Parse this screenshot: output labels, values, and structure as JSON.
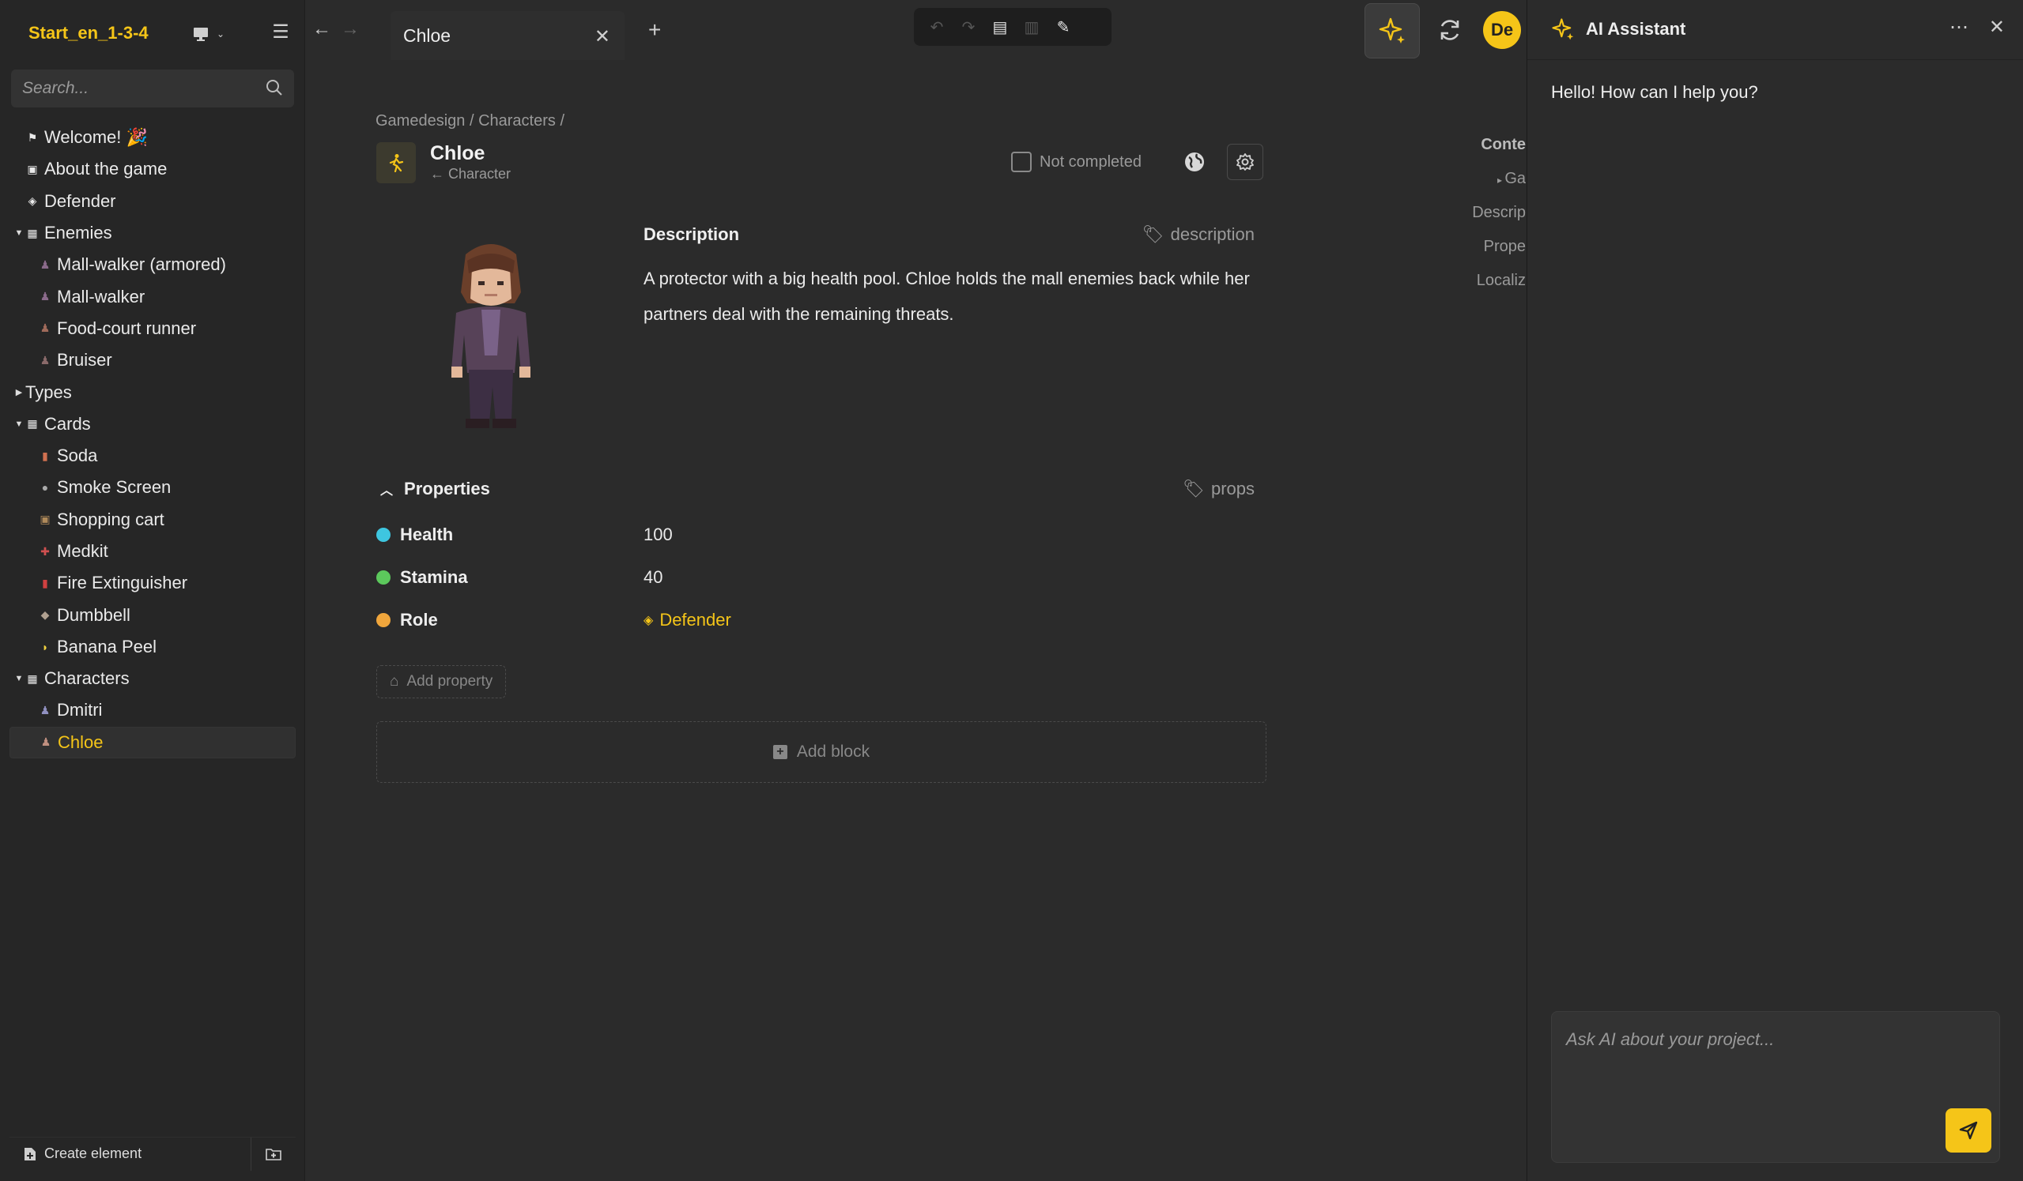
{
  "project": {
    "title": "Start_en_1-3-4"
  },
  "search": {
    "placeholder": "Search..."
  },
  "tree": {
    "welcome": "Welcome! 🎉",
    "about": "About the game",
    "defender": "Defender",
    "enemies": "Enemies",
    "enemy_items": [
      "Mall-walker (armored)",
      "Mall-walker",
      "Food-court runner",
      "Bruiser"
    ],
    "types": "Types",
    "cards": "Cards",
    "card_items": [
      "Soda",
      "Smoke Screen",
      "Shopping cart",
      "Medkit",
      "Fire Extinguisher",
      "Dumbbell",
      "Banana Peel"
    ],
    "characters": "Characters",
    "character_items": [
      "Dmitri",
      "Chloe"
    ]
  },
  "sidebar_footer": {
    "create_label": "Create element"
  },
  "tab": {
    "label": "Chloe"
  },
  "breadcrumb": "Gamedesign / Characters /",
  "entity": {
    "title": "Chloe",
    "subtitle": "← Character"
  },
  "status": {
    "label": "Not completed"
  },
  "description": {
    "heading": "Description",
    "tag": "description",
    "text": "A protector with a big health pool. Chloe holds the mall enemies back while her partners deal with the remaining threats."
  },
  "properties": {
    "heading": "Properties",
    "tag": "props",
    "items": [
      {
        "name": "Health",
        "value": "100",
        "color": "#3ec6e0"
      },
      {
        "name": "Stamina",
        "value": "40",
        "color": "#5cc85c"
      },
      {
        "name": "Role",
        "value": "Defender",
        "color": "#f0a63c"
      }
    ],
    "add_label": "Add property"
  },
  "add_block": {
    "label": "Add block"
  },
  "toc": {
    "title": "Conte",
    "items": [
      "Ga",
      "Descrip",
      "Prope",
      "Localiz"
    ]
  },
  "ai": {
    "title": "AI Assistant",
    "greeting": "Hello! How can I help you?",
    "placeholder": "Ask AI about your project..."
  },
  "user": {
    "initials": "De"
  },
  "colors": {
    "accent": "#f5c518",
    "background": "#2b2b2b",
    "sidebar": "#262626"
  }
}
